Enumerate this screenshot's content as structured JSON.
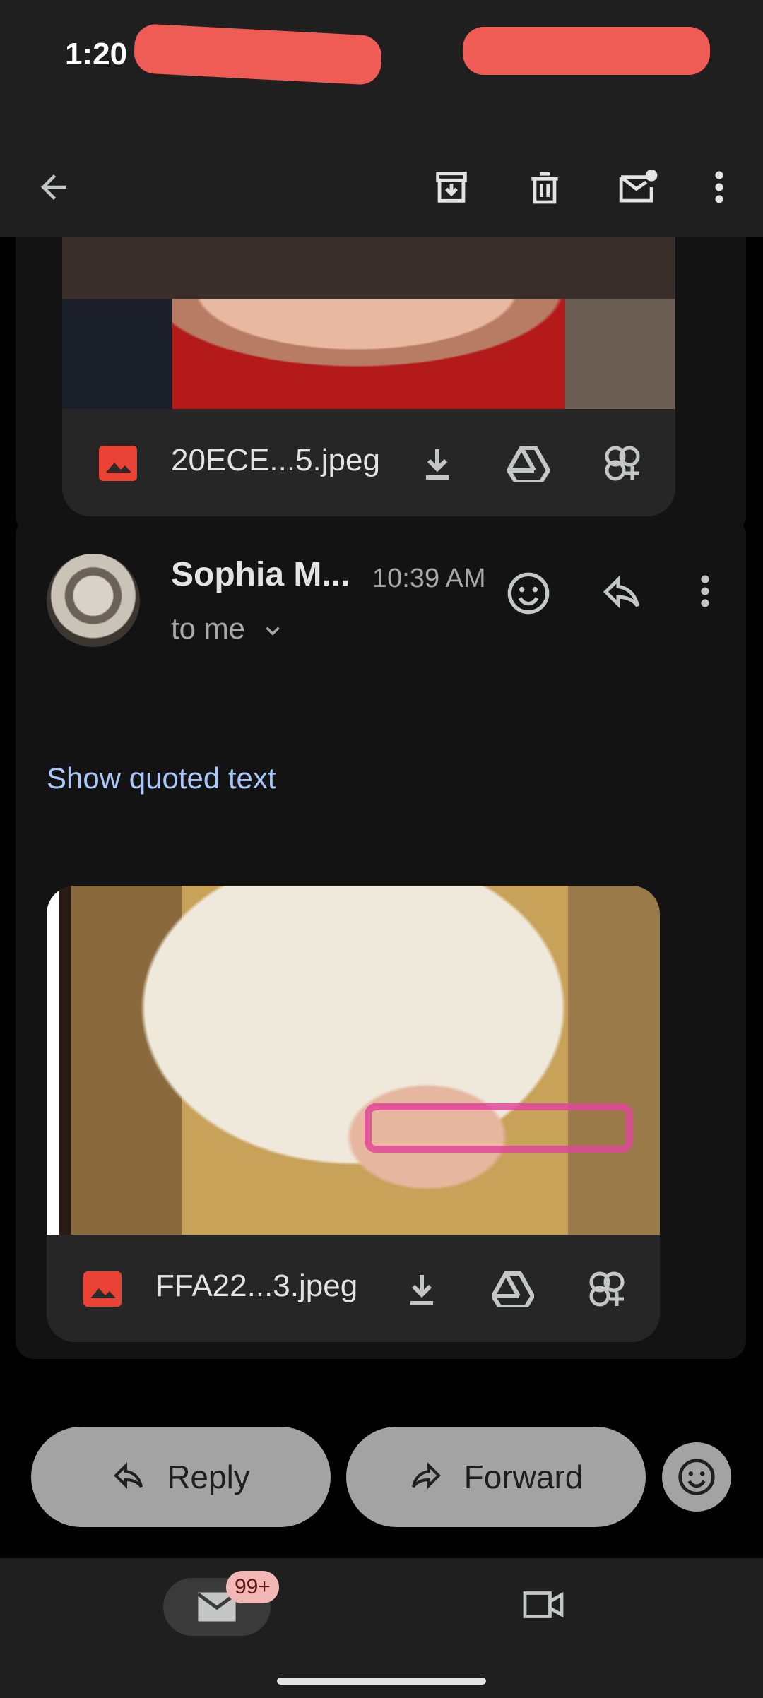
{
  "status_bar": {
    "time": "1:20"
  },
  "toolbar": {
    "icons": [
      "back-arrow-icon",
      "archive-icon",
      "delete-icon",
      "mark-unread-icon",
      "more-vert-icon"
    ]
  },
  "attachment_top": {
    "filename": "20ECE...5.jpeg"
  },
  "message": {
    "sender": "Sophia M...",
    "time": "10:39 AM",
    "recipient": "to me",
    "show_quoted": "Show quoted text",
    "attachment": {
      "filename": "FFA22...3.jpeg"
    }
  },
  "actions": {
    "reply": "Reply",
    "forward": "Forward"
  },
  "bottom_nav": {
    "mail_badge": "99+"
  }
}
